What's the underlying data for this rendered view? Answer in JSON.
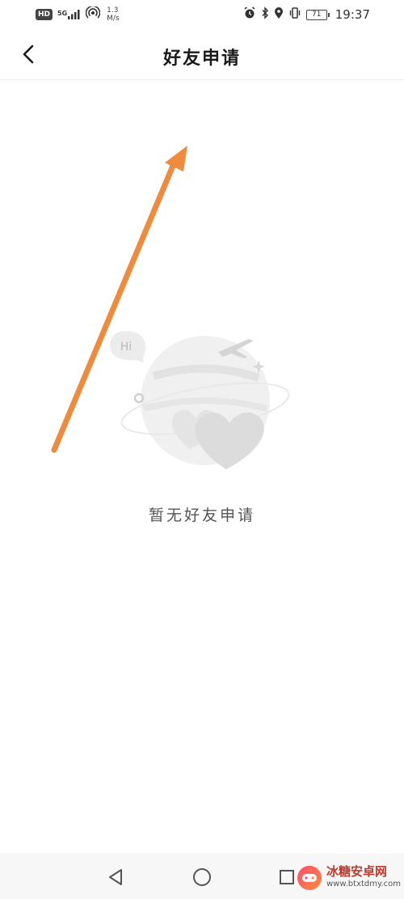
{
  "status_bar": {
    "hd_badge": "HD",
    "signal_label": "5G",
    "net_speed_value": "1.3",
    "net_speed_unit": "M/s",
    "battery_level": "71",
    "time": "19:37"
  },
  "header": {
    "title": "好友申请"
  },
  "empty_state": {
    "bubble_text": "Hi",
    "message": "暂无好友申请"
  },
  "nav_bar": {
    "back_icon": "triangle-back-icon",
    "home_icon": "circle-home-icon",
    "recent_icon": "square-recent-icon"
  },
  "watermark": {
    "title": "冰糖安卓网",
    "url": "www.btxtdmy.com"
  },
  "colors": {
    "annotation_arrow": "#f08a3c",
    "illustration_gray": "#e6e6e6"
  }
}
